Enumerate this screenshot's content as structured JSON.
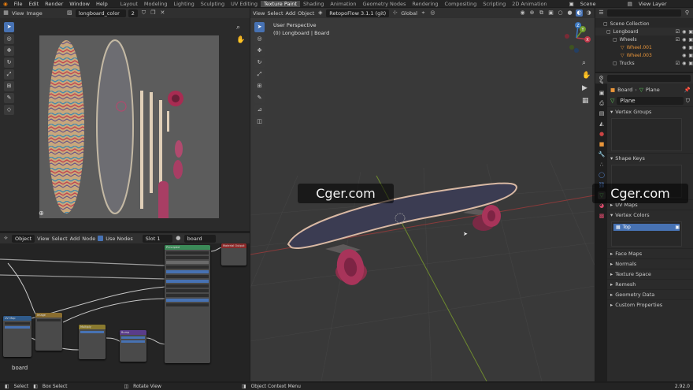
{
  "topbar": {
    "menus": [
      "File",
      "Edit",
      "Render",
      "Window",
      "Help"
    ],
    "tabs": [
      "Layout",
      "Modeling",
      "Lighting",
      "Sculpting",
      "UV Editing",
      "Texture Paint",
      "Shading",
      "Animation",
      "Geometry Nodes",
      "Rendering",
      "Compositing",
      "Scripting",
      "2D Animation"
    ],
    "active_tab": "Texture Paint",
    "scene_label": "Scene",
    "view_layer_label": "View Layer"
  },
  "image_editor": {
    "view": "View",
    "image": "Image",
    "image_name": "longboard_color",
    "users": "2"
  },
  "node_editor": {
    "type": "Object",
    "menus": [
      "View",
      "Select",
      "Add",
      "Node"
    ],
    "use_nodes": "Use Nodes",
    "slot": "Slot 1",
    "material": "board",
    "bottom_label": "board",
    "node_titles": [
      "BSDF",
      "Principled",
      "Mix",
      "UV Map",
      "Image",
      "Multiply",
      "Bump",
      "Material Output"
    ]
  },
  "viewport": {
    "menus": [
      "View",
      "Select",
      "Add",
      "Object"
    ],
    "addon": "RetopoFlow 3.1.1 (git)",
    "orientation": "Global",
    "perspective": "User Perspective",
    "object_line": "(0) Longboard | Board",
    "axes": {
      "x": "X",
      "y": "Y",
      "z": "Z"
    }
  },
  "outliner": {
    "items": [
      {
        "label": "Scene Collection",
        "depth": 0
      },
      {
        "label": "Longboard",
        "depth": 1
      },
      {
        "label": "Wheels",
        "depth": 2
      },
      {
        "label": "Wheel.001",
        "depth": 3
      },
      {
        "label": "Wheel.003",
        "depth": 3
      },
      {
        "label": "Trucks",
        "depth": 2
      }
    ]
  },
  "properties": {
    "object_name": "Board",
    "mesh_name": "Plane",
    "data_field": "Plane",
    "vertex_groups": "Vertex Groups",
    "shape_keys": "Shape Keys",
    "uv_maps": "UV Maps",
    "vertex_colors": "Vertex Colors",
    "vc_item": "Top",
    "collapsed_sections": [
      "Face Maps",
      "Normals",
      "Texture Space",
      "Remesh",
      "Geometry Data",
      "Custom Properties"
    ]
  },
  "statusbar": {
    "select": "Select",
    "box_select": "Box Select",
    "rotate": "Rotate View",
    "context_menu": "Object Context Menu",
    "version": "2.92.0"
  },
  "watermark": "Cger.com",
  "colors": {
    "accent": "#4772b3",
    "active_tab": "#4a4a4a",
    "header": "#303030"
  }
}
